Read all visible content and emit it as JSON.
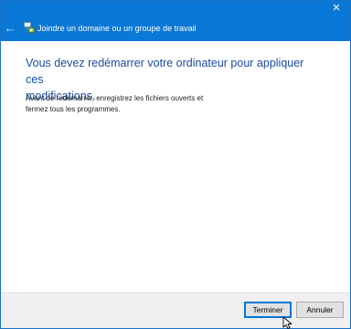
{
  "window": {
    "close_glyph": "✕"
  },
  "nav": {
    "back_glyph": "←",
    "title": "Joindre un domaine ou un groupe de travail",
    "icon": "computer-network-icon"
  },
  "content": {
    "heading_line1": "Vous devez redémarrer votre ordinateur pour appliquer ces",
    "heading_line2": "modifications.",
    "body_line1": "Avant de redémarrer, enregistrez les fichiers ouverts et",
    "body_line2": "fermez tous les programmes."
  },
  "footer": {
    "finish_label": "Terminer",
    "cancel_label": "Annuler"
  },
  "colors": {
    "title_bar": "#0a78d7",
    "heading": "#1c4ba3"
  }
}
